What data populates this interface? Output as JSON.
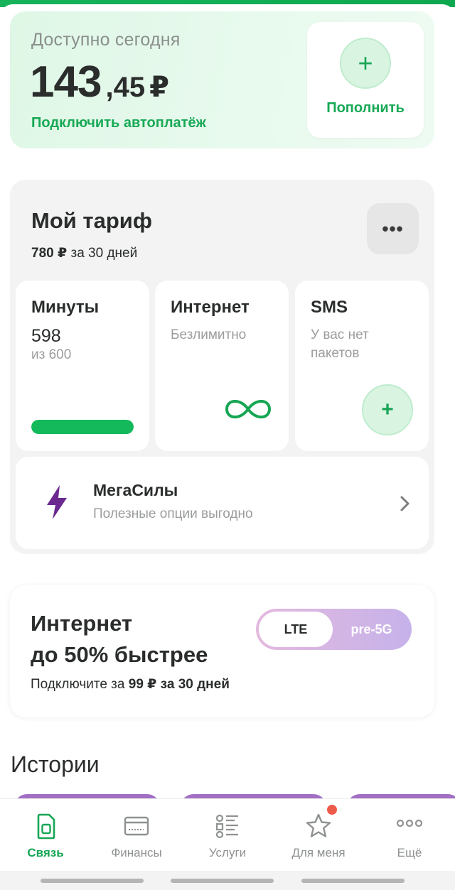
{
  "balance": {
    "caption": "Доступно сегодня",
    "integer": "143",
    "fraction": ",45",
    "currency": "₽",
    "autopay_link": "Подключить автоплатёж",
    "topup_icon": "plus-icon",
    "topup_label": "Пополнить"
  },
  "tariff": {
    "title": "Мой тариф",
    "price": "780 ₽",
    "period": "за 30 дней",
    "more_icon": "•••",
    "packs": [
      {
        "title": "Минуты",
        "value": "598",
        "sub": "из 600",
        "progress": 0.997
      },
      {
        "title": "Интернет",
        "desc": "Безлимитно",
        "icon": "infinity-icon"
      },
      {
        "title": "SMS",
        "desc": "У вас нет пакетов",
        "action_icon": "plus-icon"
      }
    ],
    "megasily": {
      "title": "МегаСилы",
      "subtitle": "Полезные опции выгодно",
      "icon": "lightning-icon"
    }
  },
  "promo": {
    "title_line1": "Интернет",
    "title_line2": "до 50% быстрее",
    "sub_prefix": "Подключите за",
    "sub_price": "99 ₽ за 30 дней",
    "toggle": {
      "option_a": "LTE",
      "option_b": "pre-5G",
      "selected": "LTE"
    }
  },
  "stories": {
    "title": "Истории"
  },
  "nav": {
    "items": [
      {
        "label": "Связь",
        "icon": "sim-card-icon",
        "active": true
      },
      {
        "label": "Финансы",
        "icon": "card-icon",
        "active": false
      },
      {
        "label": "Услуги",
        "icon": "list-icon",
        "active": false
      },
      {
        "label": "Для меня",
        "icon": "star-icon",
        "active": false,
        "badge": true
      },
      {
        "label": "Ещё",
        "icon": "more-dots-icon",
        "active": false
      }
    ]
  },
  "colors": {
    "brand_green": "#18a956",
    "progress_green": "#13b95a",
    "badge_red": "#ec5a4a",
    "megasily_purple": "#6b2a8f"
  }
}
